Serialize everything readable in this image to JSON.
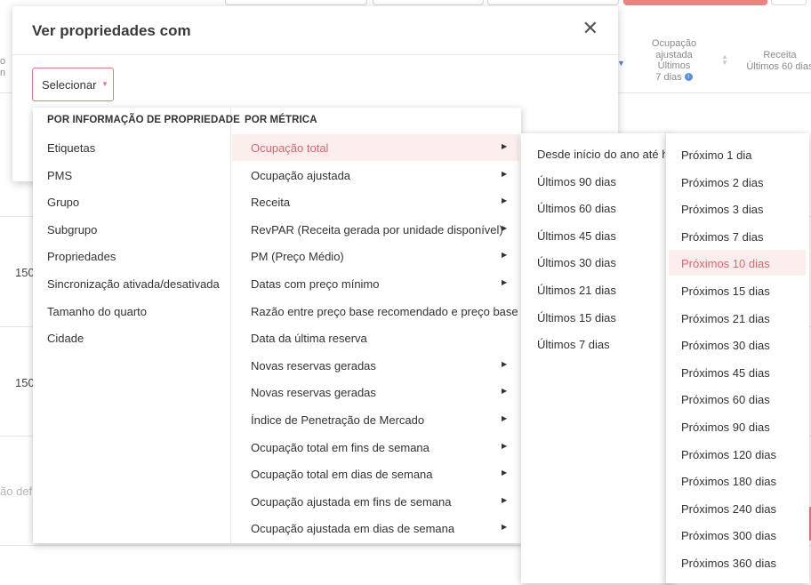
{
  "background": {
    "col_occupancy_adjusted": [
      "Ocupação",
      "ajustada",
      "Últimos",
      "7 dias"
    ],
    "col_revenue": [
      "Receita",
      "Últimos 60 dias"
    ],
    "col_left_partial": "o n",
    "row_values": [
      "150",
      "150"
    ],
    "row_muted": "ão def"
  },
  "modal": {
    "title": "Ver propriedades com",
    "select_label": "Selecionar"
  },
  "dropdown": {
    "col1_header": "POR INFORMAÇÃO DE PROPRIEDADE",
    "col2_header": "POR MÉTRICA",
    "property_items": [
      "Etiquetas",
      "PMS",
      "Grupo",
      "Subgrupo",
      "Propriedades",
      "Sincronização ativada/desativada",
      "Tamanho do quarto",
      "Cidade"
    ],
    "metric_items": [
      {
        "label": "Ocupação total",
        "submenu": true,
        "active": true
      },
      {
        "label": "Ocupação ajustada",
        "submenu": true
      },
      {
        "label": "Receita",
        "submenu": true
      },
      {
        "label": "RevPAR (Receita gerada por unidade disponível)",
        "submenu": true
      },
      {
        "label": "PM (Preço Médio)",
        "submenu": true
      },
      {
        "label": "Datas com preço mínimo",
        "submenu": true
      },
      {
        "label": "Razão entre preço base recomendado e preço base",
        "submenu": false
      },
      {
        "label": "Data da última reserva",
        "submenu": false
      },
      {
        "label": "Novas reservas geradas",
        "submenu": true
      },
      {
        "label": "Novas reservas geradas",
        "submenu": true
      },
      {
        "label": "Índice de Penetração de Mercado",
        "submenu": true
      },
      {
        "label": "Ocupação total em fins de semana",
        "submenu": true
      },
      {
        "label": "Ocupação total em dias de semana",
        "submenu": true
      },
      {
        "label": "Ocupação ajustada em fins de semana",
        "submenu": true
      },
      {
        "label": "Ocupação ajustada em dias de semana",
        "submenu": true
      }
    ],
    "past_periods": [
      "Desde início do ano até ho",
      "Últimos 90 dias",
      "Últimos 60 dias",
      "Últimos 45 dias",
      "Últimos 30 dias",
      "Últimos 21 dias",
      "Últimos 15 dias",
      "Últimos 7 dias"
    ],
    "future_periods": [
      "Próximo 1 dia",
      "Próximos 2 dias",
      "Próximos 3 dias",
      "Próximos 7 dias",
      "Próximos 10 dias",
      "Próximos 15 dias",
      "Próximos 21 dias",
      "Próximos 30 dias",
      "Próximos 45 dias",
      "Próximos 60 dias",
      "Próximos 90 dias",
      "Próximos 120 dias",
      "Próximos 180 dias",
      "Próximos 240 dias",
      "Próximos 300 dias",
      "Próximos 360 dias"
    ],
    "future_active": "Próximos 10 dias"
  },
  "icons": {
    "close": "close-icon",
    "caret": "caret-down-icon",
    "submenu": "chevron-right-icon",
    "info": "info-icon"
  },
  "colors": {
    "accent": "#e0656e",
    "active_bg": "#fdeeee",
    "sort": "#5a78d8"
  }
}
